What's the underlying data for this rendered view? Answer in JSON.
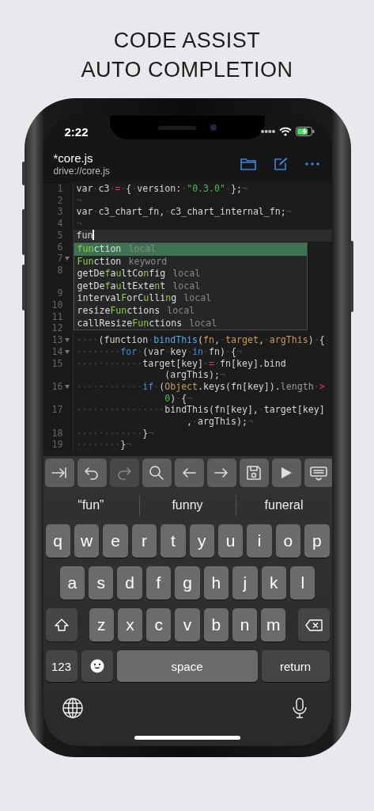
{
  "heading": [
    "CODE ASSIST",
    "AUTO COMPLETION"
  ],
  "status_bar": {
    "time": "2:22"
  },
  "editor": {
    "title": "*core.js",
    "path": "drive://core.js"
  },
  "code_lines": [
    {
      "number": "1",
      "fold": false,
      "current": false,
      "rows": [
        {
          "segments": [
            {
              "text": "var·c3·"
            },
            {
              "text": "=",
              "kind": "op"
            },
            {
              "text": "·{·version:·"
            },
            {
              "text": "\"0.3.0\"",
              "kind": "string"
            },
            {
              "text": "·};¬"
            }
          ]
        }
      ]
    },
    {
      "number": "2",
      "fold": false,
      "current": false,
      "rows": [
        {
          "segments": [
            {
              "text": "¬"
            }
          ]
        }
      ]
    },
    {
      "number": "3",
      "fold": false,
      "current": false,
      "rows": [
        {
          "segments": [
            {
              "text": "var·c3_chart_fn,·c3_chart_internal_fn;¬"
            }
          ]
        }
      ]
    },
    {
      "number": "4",
      "fold": false,
      "current": false,
      "rows": [
        {
          "segments": [
            {
              "text": "¬"
            }
          ]
        }
      ]
    },
    {
      "number": "5",
      "fold": false,
      "current": true,
      "rows": [
        {
          "segments": [
            {
              "text": "fun"
            }
          ]
        }
      ]
    },
    {
      "number": "6",
      "fold": false,
      "current": false,
      "wrapped": false
    },
    {
      "number": "7",
      "fold": true,
      "current": false,
      "wrapped": false
    },
    {
      "number": "8",
      "fold": false,
      "current": false,
      "wrapped": true
    },
    {
      "number": "9",
      "fold": false,
      "current": false,
      "wrapped": false
    },
    {
      "number": "10",
      "fold": false,
      "current": false,
      "wrapped": false
    },
    {
      "number": "11",
      "fold": false,
      "current": false,
      "wrapped": false
    },
    {
      "number": "12",
      "fold": false,
      "current": false,
      "wrapped": false
    },
    {
      "number": "13",
      "fold": true,
      "current": false,
      "rows": [
        {
          "segments": [
            {
              "text": "····(function·"
            },
            {
              "text": "bindThis",
              "kind": "function"
            },
            {
              "text": "("
            },
            {
              "text": "fn",
              "kind": "param"
            },
            {
              "text": ",·"
            },
            {
              "text": "target",
              "kind": "param"
            },
            {
              "text": ",·"
            },
            {
              "text": "argThis",
              "kind": "param"
            },
            {
              "text": ")·{"
            }
          ]
        }
      ]
    },
    {
      "number": "14",
      "fold": true,
      "current": false,
      "rows": [
        {
          "segments": [
            {
              "text": "········"
            },
            {
              "text": "for",
              "kind": "keyword"
            },
            {
              "text": "·(var·key·"
            },
            {
              "text": "in",
              "kind": "keyword"
            },
            {
              "text": "·fn)·{¬"
            }
          ]
        }
      ]
    },
    {
      "number": "15",
      "fold": false,
      "current": false,
      "rows": [
        {
          "segments": [
            {
              "text": "············target[key]·"
            },
            {
              "text": "=",
              "kind": "op"
            },
            {
              "text": "·fn[key].bind"
            }
          ]
        },
        {
          "segments": [
            {
              "text": "                (argThis);¬"
            }
          ]
        }
      ]
    },
    {
      "number": "16",
      "fold": true,
      "current": false,
      "rows": [
        {
          "segments": [
            {
              "text": "············"
            },
            {
              "text": "if",
              "kind": "keyword"
            },
            {
              "text": "·("
            },
            {
              "text": "Object",
              "kind": "param"
            },
            {
              "text": ".keys(fn[key])."
            },
            {
              "text": "length",
              "kind": "property"
            },
            {
              "text": "·"
            },
            {
              "text": ">",
              "kind": "op"
            }
          ]
        },
        {
          "segments": [
            {
              "text": "                0",
              "kind": "number"
            },
            {
              "text": ")·{¬"
            }
          ]
        }
      ]
    },
    {
      "number": "17",
      "fold": false,
      "current": false,
      "rows": [
        {
          "segments": [
            {
              "text": "················bindThis(fn[key],·target[key]"
            }
          ]
        },
        {
          "segments": [
            {
              "text": "                    ,·argThis);¬"
            }
          ]
        }
      ]
    },
    {
      "number": "18",
      "fold": false,
      "current": false,
      "rows": [
        {
          "segments": [
            {
              "text": "············}¬"
            }
          ]
        }
      ]
    },
    {
      "number": "19",
      "fold": false,
      "current": false,
      "rows": [
        {
          "segments": [
            {
              "text": "········}¬"
            }
          ]
        }
      ]
    }
  ],
  "completions": [
    {
      "label": "**fun**ction",
      "type": "local",
      "selected": true
    },
    {
      "label": "**Fun**ction",
      "type": "keyword",
      "selected": false
    },
    {
      "label": "getDe**f**a**u**ltCo**n**fig",
      "type": "local",
      "selected": false
    },
    {
      "label": "getDe**f**a**u**ltExte**n**t",
      "type": "local",
      "selected": false
    },
    {
      "label": "interval**F**orC**u**lli**n**g",
      "type": "local",
      "selected": false
    },
    {
      "label": "resize**Fun**ctions",
      "type": "local",
      "selected": false
    },
    {
      "label": "callResize**Fun**ctions",
      "type": "local",
      "selected": false
    }
  ],
  "toolbar": [
    {
      "kind": "tab",
      "disabled": false
    },
    {
      "kind": "undo",
      "disabled": false
    },
    {
      "kind": "redo",
      "disabled": true
    },
    {
      "kind": "search",
      "disabled": false
    },
    {
      "kind": "left",
      "disabled": false
    },
    {
      "kind": "right",
      "disabled": false
    },
    {
      "kind": "save",
      "disabled": false
    },
    {
      "kind": "run",
      "disabled": false
    },
    {
      "kind": "hide-keyboard",
      "disabled": false
    }
  ],
  "suggestions": [
    "“fun”",
    "funny",
    "funeral"
  ],
  "keyboard": {
    "rows": [
      [
        "q",
        "w",
        "e",
        "r",
        "t",
        "y",
        "u",
        "i",
        "o",
        "p"
      ],
      [
        "a",
        "s",
        "d",
        "f",
        "g",
        "h",
        "j",
        "k",
        "l"
      ],
      [
        "z",
        "x",
        "c",
        "v",
        "b",
        "n",
        "m"
      ]
    ],
    "numbers_key": "123",
    "space_key": "space",
    "return_key": "return"
  }
}
